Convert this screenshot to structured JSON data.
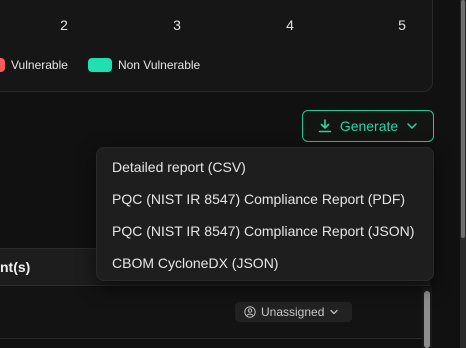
{
  "chart": {
    "x_ticks": [
      "2",
      "3",
      "4",
      "5"
    ],
    "legend": [
      {
        "label": "Vulnerable",
        "color": "#f25c5c"
      },
      {
        "label": "Non Vulnerable",
        "color": "#1fe0b0"
      }
    ]
  },
  "generate": {
    "label": "Generate",
    "accent": "#2fd4a3"
  },
  "menu": {
    "items": [
      {
        "label": "Detailed report (CSV)"
      },
      {
        "label": "PQC (NIST IR 8547) Compliance Report (PDF)"
      },
      {
        "label": "PQC (NIST IR 8547) Compliance Report (JSON)"
      },
      {
        "label": "CBOM CycloneDX (JSON)"
      }
    ]
  },
  "table": {
    "column_title": "nt(s)",
    "rows": [
      {
        "assignee": "Unassigned"
      }
    ]
  }
}
